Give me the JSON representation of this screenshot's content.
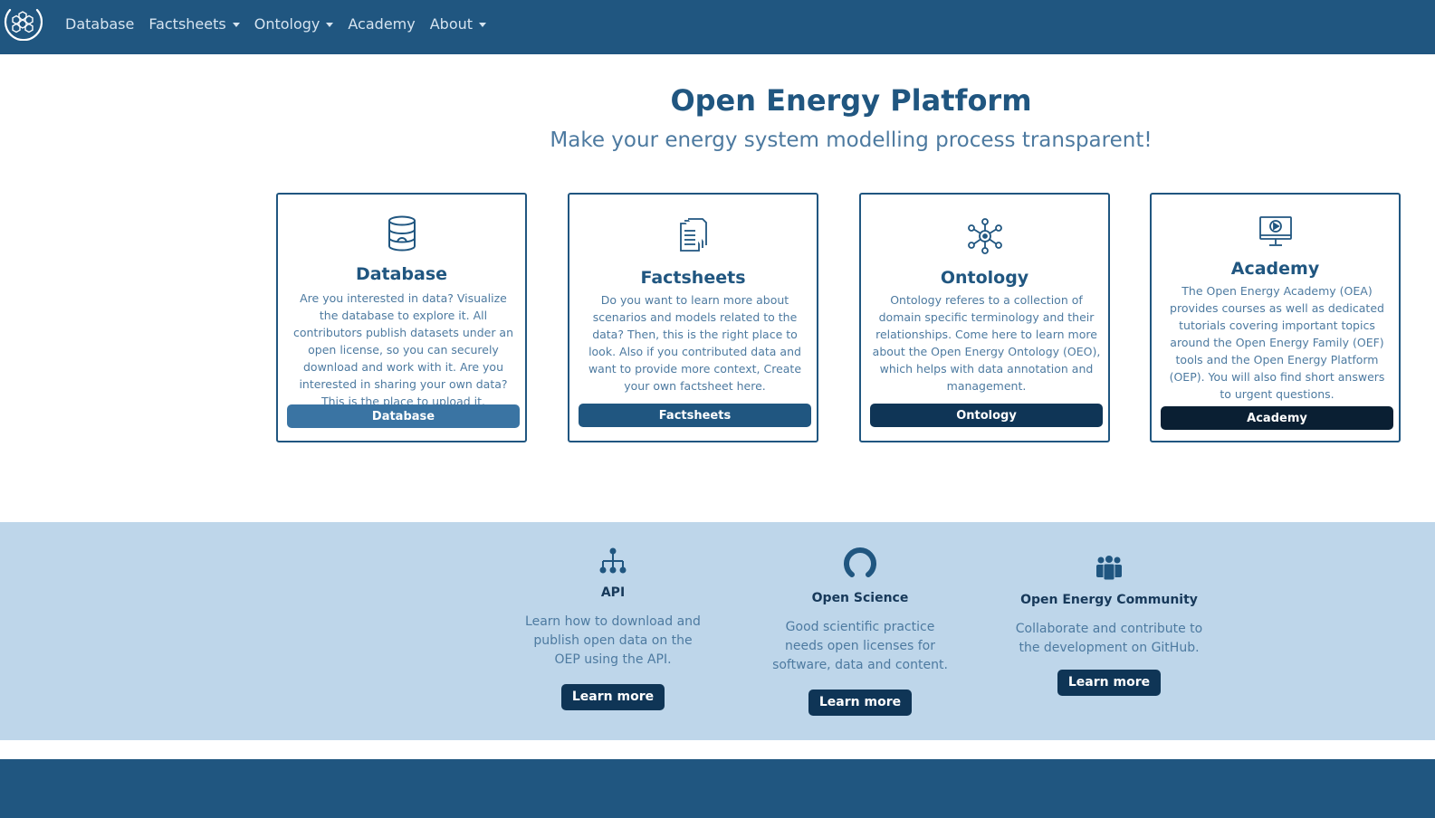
{
  "nav": {
    "items": [
      {
        "label": "Database",
        "dropdown": false
      },
      {
        "label": "Factsheets",
        "dropdown": true
      },
      {
        "label": "Ontology",
        "dropdown": true
      },
      {
        "label": "Academy",
        "dropdown": false
      },
      {
        "label": "About",
        "dropdown": true
      }
    ]
  },
  "hero": {
    "title": "Open Energy Platform",
    "subtitle": "Make your energy system modelling process transparent!"
  },
  "cards": [
    {
      "title": "Database",
      "icon": "database-icon",
      "text": "Are you interested in data? Visualize the database to explore it. All contributors publish datasets under an open license, so you can securely download and work with it. Are you interested in sharing your own data? This is the place to upload it.",
      "button": "Database",
      "button_color": "#3a74a3"
    },
    {
      "title": "Factsheets",
      "icon": "factsheets-icon",
      "text": "Do you want to learn more about scenarios and models related to the data? Then, this is the right place to look. Also if you contributed data and want to provide more context, Create your own factsheet here.",
      "button": "Factsheets",
      "button_color": "#205680"
    },
    {
      "title": "Ontology",
      "icon": "ontology-icon",
      "text": "Ontology referes to a collection of domain specific terminology and their relationships. Come here to learn more about the Open Energy Ontology (OEO), which helps with data annotation and management.",
      "button": "Ontology",
      "button_color": "#0f3556"
    },
    {
      "title": "Academy",
      "icon": "academy-icon",
      "text": "The Open Energy Academy (OEA) provides courses as well as dedicated tutorials covering important topics around the Open Energy Family (OEF) tools and the Open Energy Platform (OEP). You will also find short answers to urgent questions.",
      "button": "Academy",
      "button_color": "#0a1f33"
    }
  ],
  "features": [
    {
      "title": "API",
      "icon": "api-icon",
      "text": "Learn how to download and publish open data on the OEP using the API.",
      "button": "Learn more"
    },
    {
      "title": "Open Science",
      "icon": "open-access-icon",
      "text": "Good scientific practice needs open licenses for software, data and content.",
      "button": "Learn more"
    },
    {
      "title": "Open Energy Community",
      "icon": "community-icon",
      "text": "Collaborate and contribute to the development on GitHub.",
      "button": "Learn more"
    }
  ],
  "colors": {
    "primary": "#205680",
    "dark": "#0f3556",
    "band": "#bed6ea",
    "muted_text": "#4d7aa0"
  }
}
